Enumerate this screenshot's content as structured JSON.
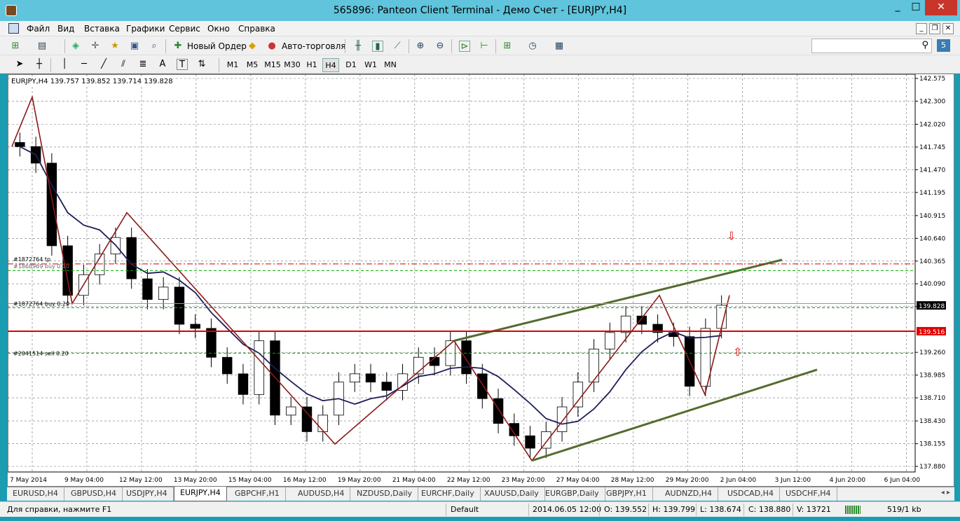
{
  "window": {
    "title": "565896: Panteon Client Terminal - Демо Счет - [EURJPY,H4]",
    "min": "_",
    "max": "□",
    "close": "✕"
  },
  "menu": [
    "Файл",
    "Вид",
    "Вставка",
    "Графики",
    "Сервис",
    "Окно",
    "Справка"
  ],
  "mdi": {
    "min": "_",
    "restore": "❐",
    "close": "✕"
  },
  "toolbar1": {
    "new_order": "Новый Ордер",
    "auto_trading": "Авто-торговля"
  },
  "toolbar2": {
    "timeframes": [
      "M1",
      "M5",
      "M15",
      "M30",
      "H1",
      "H4",
      "D1",
      "W1",
      "MN"
    ],
    "active_tf": "H4",
    "text_tool": "A",
    "label_tool": "T"
  },
  "search": {
    "placeholder": "",
    "value": ""
  },
  "messages_badge": "5",
  "chart": {
    "header": "EURJPY,H4  139.757 139.852 139.714 139.828",
    "price_labels": [
      "142.575",
      "142.300",
      "142.020",
      "141.745",
      "141.470",
      "141.195",
      "140.915",
      "140.640",
      "140.365",
      "140.090",
      "139.815",
      "139.260",
      "138.985",
      "138.710",
      "138.430",
      "138.155",
      "137.880"
    ],
    "bid_label": "139.828",
    "red_label": "139.516",
    "time_labels": [
      "7 May 2014",
      "9 May 04:00",
      "12 May 12:00",
      "13 May 20:00",
      "15 May 04:00",
      "16 May 12:00",
      "19 May 20:00",
      "21 May 04:00",
      "22 May 12:00",
      "23 May 20:00",
      "27 May 04:00",
      "28 May 12:00",
      "29 May 20:00",
      "2 Jun 04:00",
      "3 Jun 12:00",
      "4 Jun 20:00",
      "6 Jun 04:00"
    ],
    "order_labels": {
      "tp": "#1872764 tp",
      "buy_hidden": "#1868969 buy 0.10",
      "buy": "#1872764 buy 0.20",
      "sell": "#2041514 sell 0.20"
    },
    "colors": {
      "bull": "#ffffff",
      "bear": "#000000",
      "ma": "#1e1e5a",
      "zigzag": "#8b1a1a",
      "channel": "#556b2f",
      "hline": "#e00000",
      "dash_green": "#00aa00",
      "dash_red": "#d00000",
      "grid": "#000000"
    }
  },
  "chart_data": {
    "type": "candlestick",
    "symbol": "EURJPY",
    "timeframe": "H4",
    "ohlc": {
      "open": 139.757,
      "high": 139.852,
      "low": 139.714,
      "close": 139.828
    },
    "ylim": [
      137.88,
      142.575
    ],
    "x": [
      "7 May 2014",
      "9 May 04:00",
      "12 May 12:00",
      "13 May 20:00",
      "15 May 04:00",
      "16 May 12:00",
      "19 May 20:00",
      "21 May 04:00",
      "22 May 12:00",
      "23 May 20:00",
      "27 May 04:00",
      "28 May 12:00",
      "29 May 20:00",
      "2 Jun 04:00",
      "3 Jun 12:00",
      "4 Jun 20:00",
      "6 Jun 04:00"
    ],
    "closes": [
      141.75,
      141.55,
      140.55,
      139.95,
      140.2,
      140.45,
      140.65,
      140.15,
      139.9,
      140.05,
      139.6,
      139.55,
      139.2,
      139.0,
      138.75,
      139.4,
      138.5,
      138.6,
      138.3,
      138.5,
      138.9,
      139.0,
      138.9,
      138.8,
      139.0,
      139.2,
      139.1,
      139.4,
      139.0,
      138.7,
      138.4,
      138.25,
      138.1,
      138.3,
      138.6,
      138.9,
      139.3,
      139.5,
      139.7,
      139.6,
      139.5,
      139.45,
      138.85,
      139.55,
      139.83
    ],
    "zigzag": [
      141.75,
      142.35,
      139.85,
      140.95,
      138.15,
      139.4,
      137.95,
      139.95,
      138.75,
      139.95
    ],
    "levels": {
      "tp": 140.33,
      "buy": 139.85,
      "red_line": 139.516,
      "green_buy": 139.8,
      "green_top": 140.25,
      "sell": 139.25
    }
  },
  "tabs": [
    "EURUSD,H4",
    "GBPUSD,H4",
    "USDJPY,H4",
    "EURJPY,H4",
    "GBPCHF,H1",
    "AUDUSD,H4",
    "NZDUSD,Daily",
    "EURCHF,Daily",
    "XAUUSD,Daily",
    "EURGBP,Daily",
    "GBPJPY,H1",
    "AUDNZD,H4",
    "USDCAD,H4",
    "USDCHF,H4"
  ],
  "active_tab": "EURJPY,H4",
  "tab_arrows": "◂ ▸",
  "status": {
    "help": "Для справки, нажмите F1",
    "profile": "Default",
    "time": "2014.06.05 12:00",
    "open": "O: 139.552",
    "high": "H: 139.799",
    "low": "L: 138.674",
    "close": "C: 138.880",
    "volume": "V: 13721",
    "traffic": "519/1 kb"
  }
}
